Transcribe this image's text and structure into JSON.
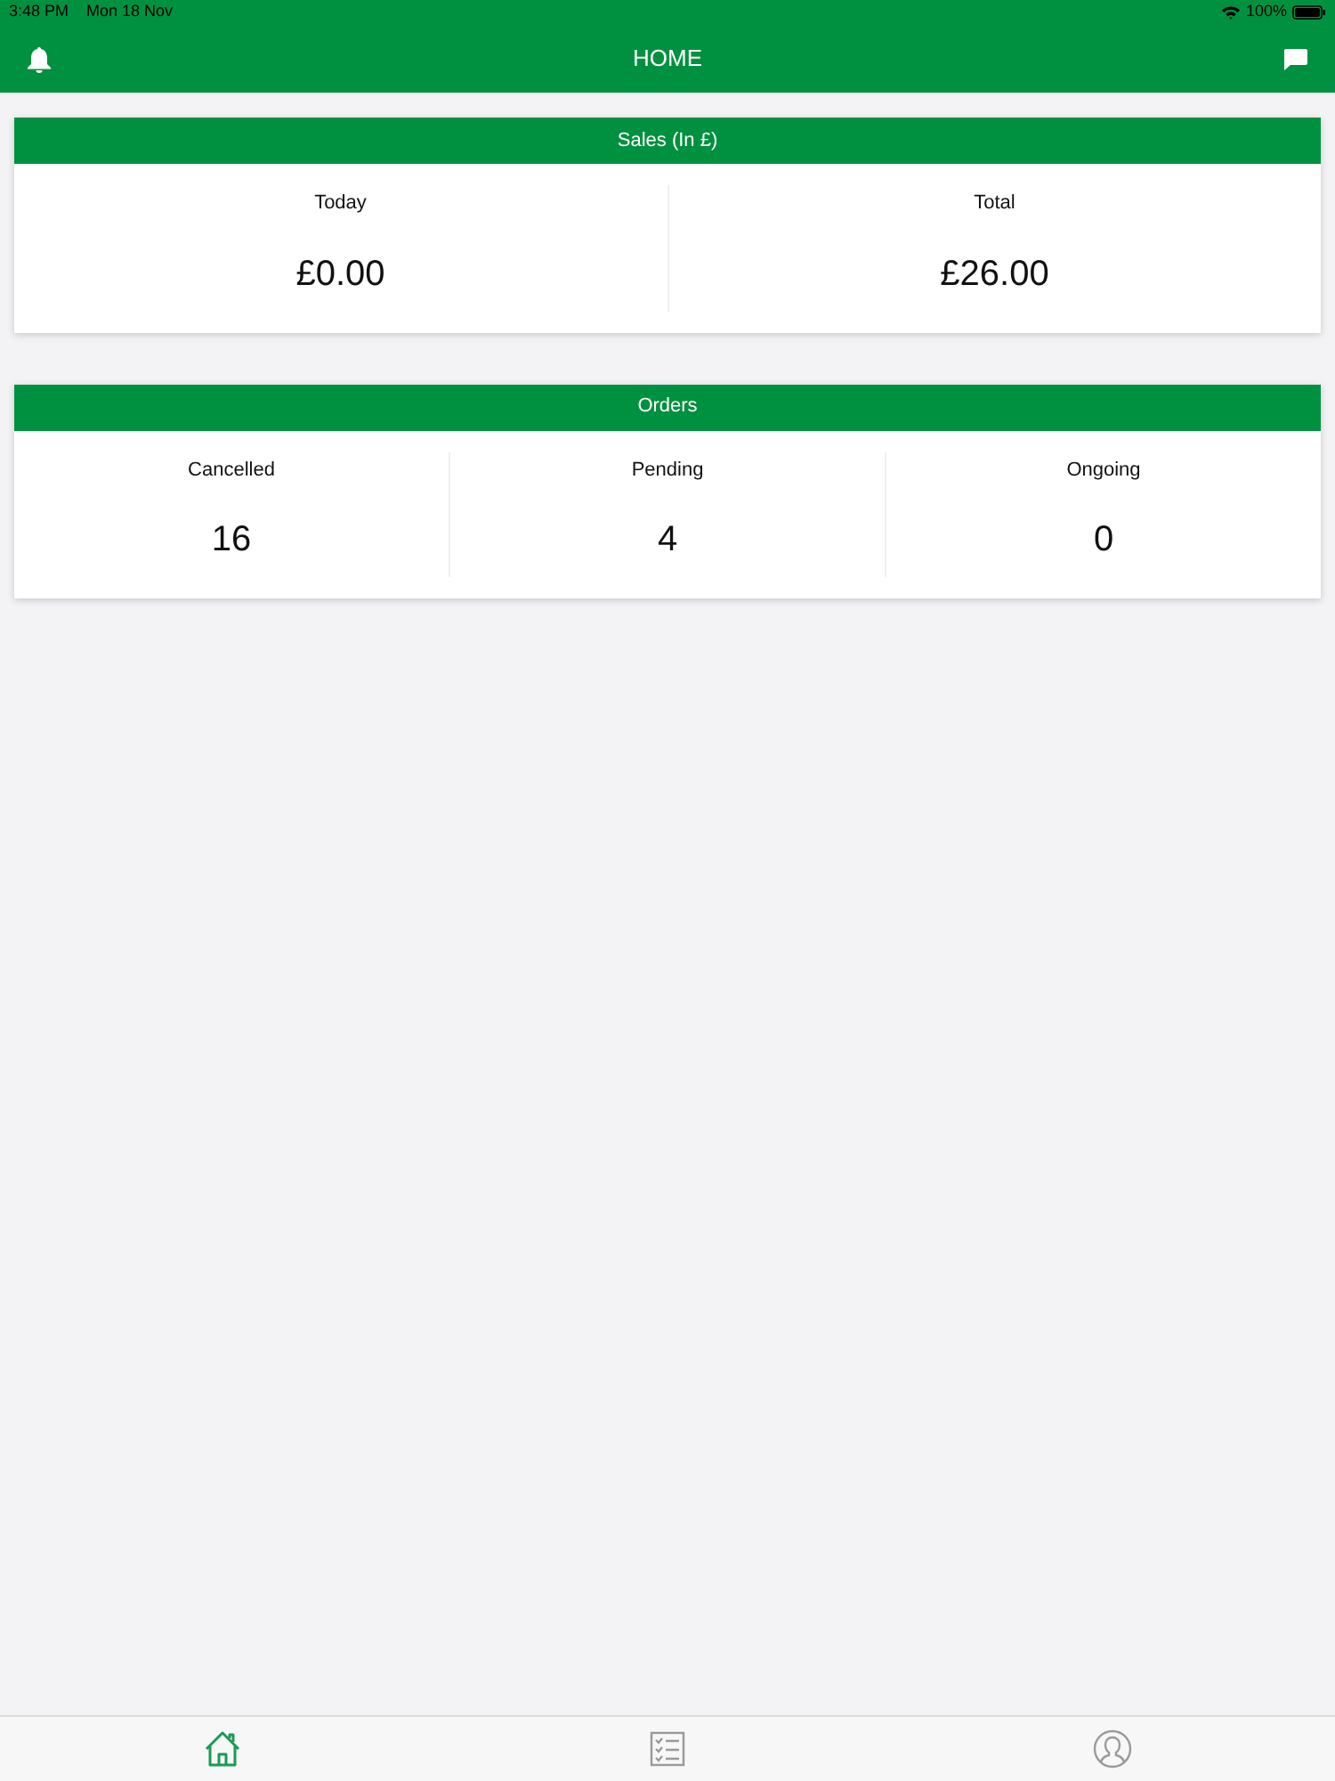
{
  "status_bar": {
    "time": "3:48 PM",
    "date": "Mon 18 Nov",
    "battery": "100%"
  },
  "nav_bar": {
    "title": "HOME"
  },
  "cards": [
    {
      "title": "Sales (In £)",
      "stats": [
        {
          "label": "Today",
          "value": "£0.00"
        },
        {
          "label": "Total",
          "value": "£26.00"
        }
      ]
    },
    {
      "title": "Orders",
      "stats": [
        {
          "label": "Cancelled",
          "value": "16"
        },
        {
          "label": "Pending",
          "value": "4"
        },
        {
          "label": "Ongoing",
          "value": "0"
        }
      ]
    }
  ],
  "tab_bar": {
    "tabs": [
      {
        "kind": "home",
        "selected": true
      },
      {
        "kind": "list",
        "selected": false
      },
      {
        "kind": "profile",
        "selected": false
      }
    ]
  }
}
